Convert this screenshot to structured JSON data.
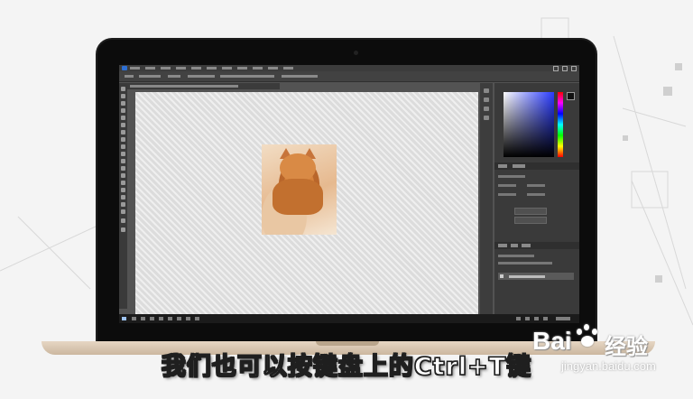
{
  "caption": "我们也可以按键盘上的Ctrl+T键",
  "watermark": {
    "bai_text": "Bai",
    "brand_text": "经验",
    "url": "jingyan.baidu.com"
  },
  "app": {
    "name": "Photoshop",
    "accent": "#2e6fd3"
  },
  "colors": {
    "foreground": "#111111",
    "picker_hue": "#2a3bff"
  }
}
